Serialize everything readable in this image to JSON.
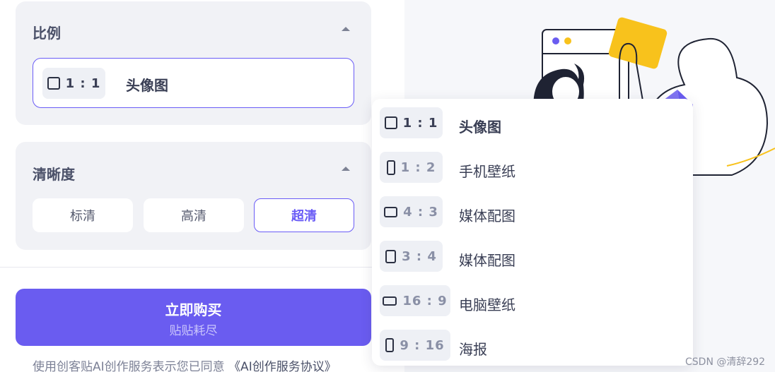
{
  "ratio_panel": {
    "title": "比例",
    "selected": {
      "ratio": "1 : 1",
      "label": "头像图",
      "icon": "square-ratio-icon"
    }
  },
  "quality_panel": {
    "title": "清晰度",
    "options": [
      {
        "label": "标清",
        "active": false
      },
      {
        "label": "高清",
        "active": false
      },
      {
        "label": "超清",
        "active": true
      }
    ]
  },
  "buy_button": {
    "title": "立即购买",
    "subtitle": "贴贴耗尽"
  },
  "agreement": {
    "text": "使用创客贴AI创作服务表示您已同意",
    "link": "《AI创作服务协议》"
  },
  "dropdown": {
    "items": [
      {
        "ratio": "1 : 1",
        "label": "头像图",
        "icon": "square-ratio-icon",
        "selected": true
      },
      {
        "ratio": "1 : 2",
        "label": "手机壁纸",
        "icon": "phone-ratio-icon",
        "selected": false
      },
      {
        "ratio": "4 : 3",
        "label": "媒体配图",
        "icon": "landscape-ratio-icon",
        "selected": false
      },
      {
        "ratio": "3 : 4",
        "label": "媒体配图",
        "icon": "portrait-ratio-icon",
        "selected": false
      },
      {
        "ratio": "16 : 9",
        "label": "电脑壁纸",
        "icon": "widescreen-ratio-icon",
        "selected": false
      },
      {
        "ratio": "9 : 16",
        "label": "海报",
        "icon": "tall-ratio-icon",
        "selected": false
      }
    ]
  },
  "watermark": "CSDN @清辞292",
  "colors": {
    "accent": "#6a5cf0",
    "illustration_yellow": "#f8c21c"
  }
}
